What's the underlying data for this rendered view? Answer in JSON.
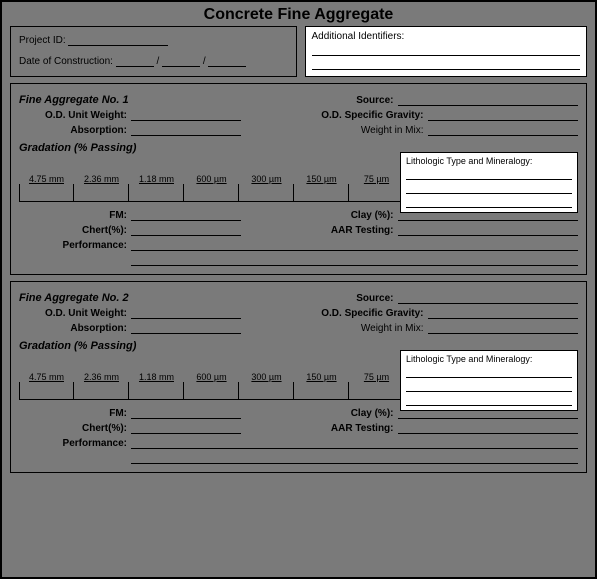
{
  "title": "Concrete Fine Aggregate",
  "topLeft": {
    "projectId": "Project ID:",
    "dateOfConstruction": "Date of Construction:"
  },
  "topRight": {
    "additionalIdentifiers": "Additional Identifiers:"
  },
  "agg": [
    {
      "heading": "Fine Aggregate No. 1",
      "source": "Source:",
      "odUnitWeight": "O.D. Unit Weight:",
      "odSpecificGravity": "O.D. Specific Gravity:",
      "absorption": "Absorption:",
      "weightInMix": "Weight in Mix:",
      "gradation": "Gradation (% Passing)",
      "lithologic": "Lithologic Type and Mineralogy:",
      "gradCols": [
        "4.75 mm",
        "2.36 mm",
        "1.18 mm",
        "600 µm",
        "300 µm",
        "150 µm",
        "75 µm"
      ],
      "fm": "FM:",
      "clay": "Clay (%):",
      "chert": "Chert(%):",
      "aar": "AAR Testing:",
      "performance": "Performance:"
    },
    {
      "heading": "Fine Aggregate No. 2",
      "source": "Source:",
      "odUnitWeight": "O.D. Unit Weight:",
      "odSpecificGravity": "O.D. Specific Gravity:",
      "absorption": "Absorption:",
      "weightInMix": "Weight in Mix:",
      "gradation": "Gradation (% Passing)",
      "lithologic": "Lithologic Type and Mineralogy:",
      "gradCols": [
        "4.75 mm",
        "2.36 mm",
        "1.18 mm",
        "600 µm",
        "300 µm",
        "150 µm",
        "75 µm"
      ],
      "fm": "FM:",
      "clay": "Clay (%):",
      "chert": "Chert(%):",
      "aar": "AAR Testing:",
      "performance": "Performance:"
    }
  ]
}
